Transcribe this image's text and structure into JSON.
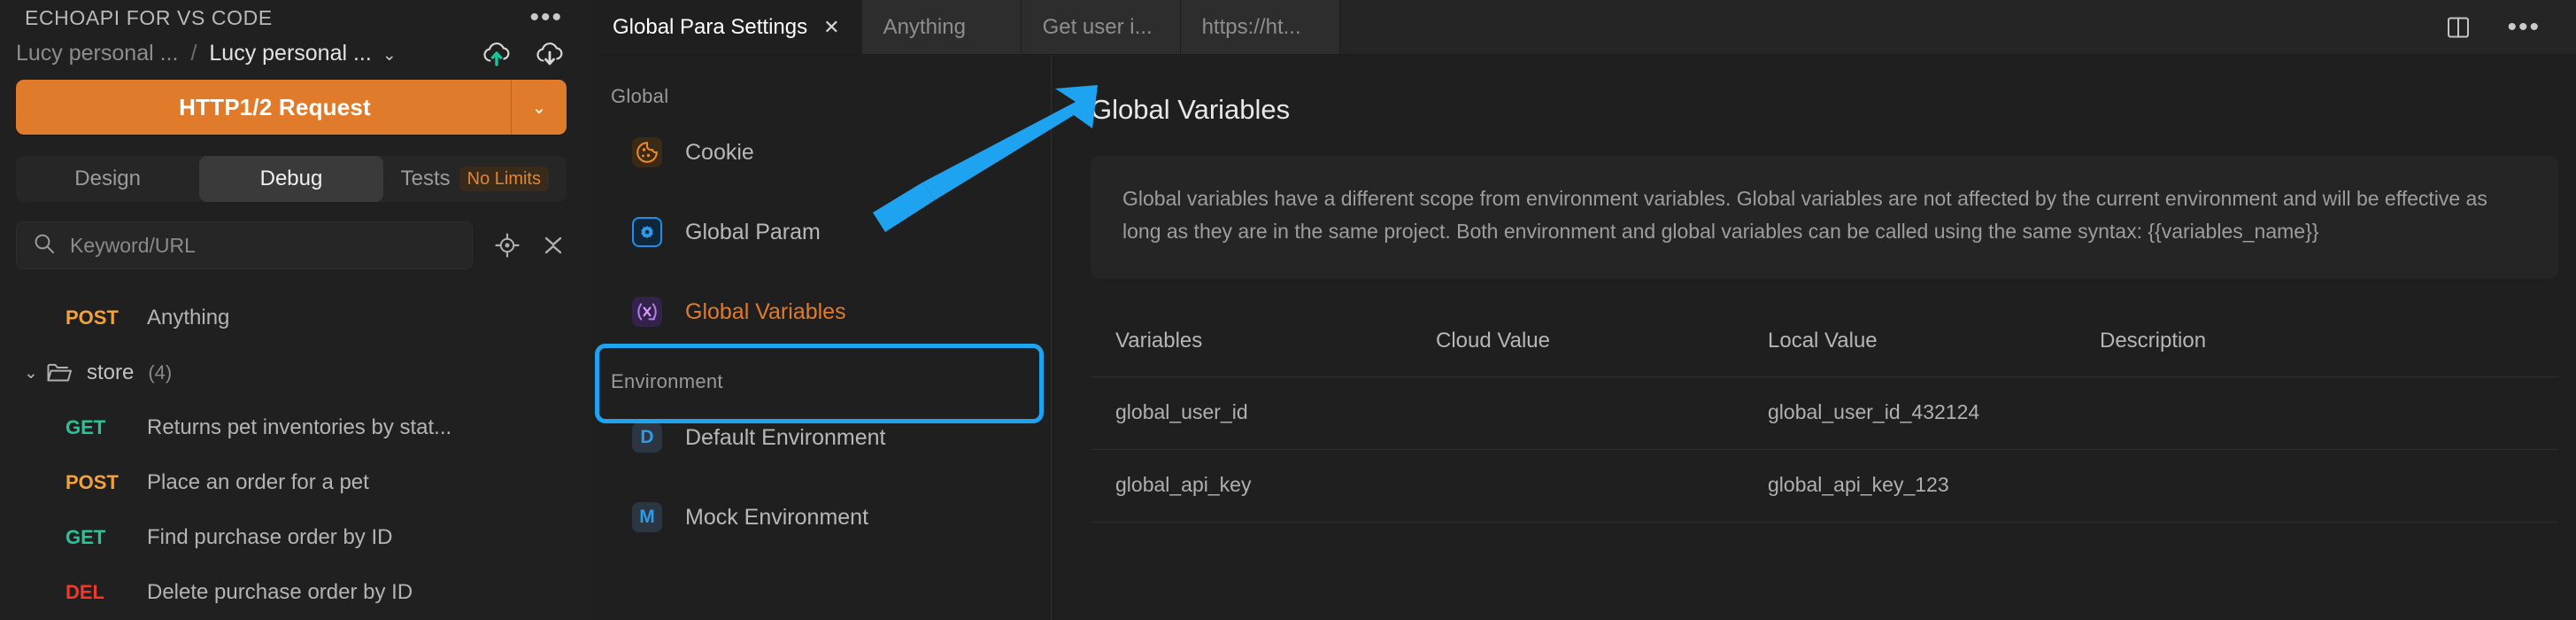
{
  "sidebar": {
    "title": "ECHOAPI FOR VS CODE",
    "more_label": "•••",
    "breadcrumb": {
      "parent": "Lucy personal ...",
      "separator": "/",
      "current": "Lucy personal ...",
      "caret": "⌄"
    },
    "cloud_icons": [
      {
        "name": "cloud-upload-icon",
        "title": "Upload"
      },
      {
        "name": "cloud-download-icon",
        "title": "Download"
      }
    ],
    "request_button": {
      "label": "HTTP1/2 Request",
      "caret": "⌄"
    },
    "segments": [
      {
        "label": "Design",
        "active": false
      },
      {
        "label": "Debug",
        "active": true
      },
      {
        "label": "Tests",
        "badge": "No Limits",
        "active": false
      }
    ],
    "search": {
      "placeholder": "Keyword/URL",
      "value": ""
    },
    "tree": [
      {
        "type": "request",
        "method": "POST",
        "name": "Anything",
        "indent": 1
      },
      {
        "type": "folder",
        "caret": "⌄",
        "name": "store",
        "count": "(4)",
        "indent": 0
      },
      {
        "type": "request",
        "method": "GET",
        "name": "Returns pet inventories by stat...",
        "indent": 1
      },
      {
        "type": "request",
        "method": "POST",
        "name": "Place an order for a pet",
        "indent": 1
      },
      {
        "type": "request",
        "method": "GET",
        "name": "Find purchase order by ID",
        "indent": 1
      },
      {
        "type": "request",
        "method": "DEL",
        "name": "Delete purchase order by ID",
        "indent": 1
      }
    ]
  },
  "tabs": [
    {
      "label": "Global Para Settings",
      "active": true,
      "close": "✕"
    },
    {
      "label": "Anything",
      "active": false
    },
    {
      "label": "Get user i...",
      "active": false
    },
    {
      "label": "https://ht...",
      "active": false
    }
  ],
  "tabbar_actions": [
    {
      "name": "split-editor-icon"
    },
    {
      "name": "more-actions-icon",
      "label": "•••"
    }
  ],
  "navpanel": {
    "groups": [
      {
        "label": "Global",
        "items": [
          {
            "label": "Cookie",
            "icon": "cookie-icon",
            "selected": false
          },
          {
            "label": "Global Param",
            "icon": "global-param-icon",
            "selected": false
          },
          {
            "label": "Global Variables",
            "icon": "global-variables-icon",
            "selected": true
          }
        ]
      },
      {
        "label": "Environment",
        "items": [
          {
            "label": "Default Environment",
            "icon": "environment-icon",
            "badge": "D",
            "selected": false
          },
          {
            "label": "Mock Environment",
            "icon": "environment-icon",
            "badge": "M",
            "selected": false
          }
        ]
      }
    ]
  },
  "content": {
    "title": "Global Variables",
    "description": "Global variables have a different scope from environment variables. Global variables are not affected by the current environment and will be effective as long as they are in the same project. Both environment and global variables can be called using the same syntax: {{variables_name}}",
    "table": {
      "headers": [
        "Variables",
        "Cloud Value",
        "Local Value",
        "Description"
      ],
      "rows": [
        {
          "variable": "global_user_id",
          "cloud_value": "",
          "local_value": "global_user_id_432124",
          "description": ""
        },
        {
          "variable": "global_api_key",
          "cloud_value": "",
          "local_value": "global_api_key_123",
          "description": ""
        }
      ]
    }
  },
  "annotation": {
    "arrow_color": "#1ea3f0",
    "highlight_color": "#1ea3f0"
  },
  "colors": {
    "accent_orange": "#e07b2b",
    "method_post": "#f0a33c",
    "method_get": "#27c49a",
    "method_del": "#f0392b",
    "highlight_blue": "#1ea3f0"
  }
}
